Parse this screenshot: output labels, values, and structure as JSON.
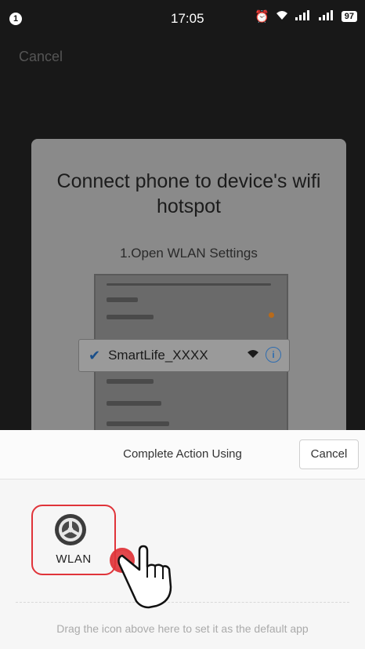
{
  "status_bar": {
    "notification_count": "1",
    "time": "17:05",
    "battery": "97",
    "icons": [
      "alarm-icon",
      "wifi-icon",
      "signal-icon",
      "signal-icon",
      "battery-icon"
    ]
  },
  "top_bar": {
    "cancel_label": "Cancel"
  },
  "card": {
    "title": "Connect phone to device's wifi hotspot",
    "step": "1.Open WLAN Settings",
    "wifi_network": "SmartLife_XXXX"
  },
  "sheet": {
    "title": "Complete Action Using",
    "cancel_label": "Cancel",
    "apps": [
      {
        "label": "WLAN",
        "icon": "settings-gear-icon"
      }
    ],
    "drag_hint": "Drag the icon above here to set it as the default app"
  },
  "colors": {
    "highlight": "#e0343a",
    "wifi_accent": "#2f6db0"
  }
}
